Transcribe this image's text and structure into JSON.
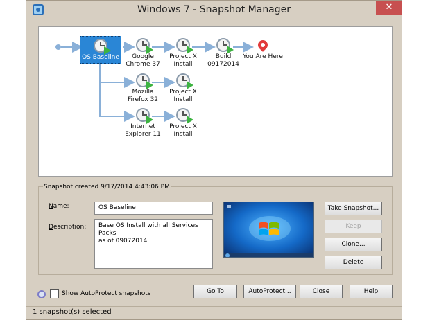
{
  "window": {
    "title": "Windows 7 - Snapshot Manager",
    "close_glyph": "✕"
  },
  "tree": {
    "nodes": [
      {
        "id": "os-baseline",
        "label": "OS Baseline",
        "icon": "snapshot-clock-icon",
        "selected": true
      },
      {
        "id": "google-chrome-37",
        "label": "Google\nChrome 37",
        "icon": "snapshot-clock-icon"
      },
      {
        "id": "project-x-install-1",
        "label": "Project X\nInstall",
        "icon": "snapshot-clock-icon"
      },
      {
        "id": "build-09172014",
        "label": "Build\n09172014",
        "icon": "snapshot-clock-icon"
      },
      {
        "id": "you-are-here",
        "label": "You Are Here",
        "icon": "location-pin-icon"
      },
      {
        "id": "mozilla-firefox-32",
        "label": "Mozilla\nFirefox 32",
        "icon": "snapshot-clock-icon"
      },
      {
        "id": "project-x-install-2",
        "label": "Project X\nInstall",
        "icon": "snapshot-clock-icon"
      },
      {
        "id": "internet-explorer-11",
        "label": "Internet\nExplorer 11",
        "icon": "snapshot-clock-icon"
      },
      {
        "id": "project-x-install-3",
        "label": "Project X\nInstall",
        "icon": "snapshot-clock-icon"
      }
    ]
  },
  "details": {
    "header": "Snapshot created 9/17/2014 4:43:06 PM",
    "name_label_u": "N",
    "name_label_rest": "ame:",
    "name_value": "OS Baseline",
    "description_label_u": "D",
    "description_label_rest": "escription:",
    "description_value": "Base OS Install with all Services Packs\nas of 09072014",
    "thumbnail": "windows-7-desktop-thumbnail"
  },
  "actions": {
    "take_snapshot": "Take Snapshot...",
    "keep": "Keep",
    "clone": "Clone...",
    "delete": "Delete"
  },
  "footer": {
    "show_autoprotect": "Show AutoProtect snapshots",
    "go_to": "Go To",
    "autoprotect": "AutoProtect...",
    "close": "Close",
    "help": "Help"
  },
  "status": {
    "text": "1 snapshot(s) selected"
  },
  "colors": {
    "window_bg": "#d7cfc2",
    "selection": "#2a86d6",
    "play_green": "#3db341",
    "pin_red": "#e23b3b",
    "connector": "#8ab0d8"
  }
}
